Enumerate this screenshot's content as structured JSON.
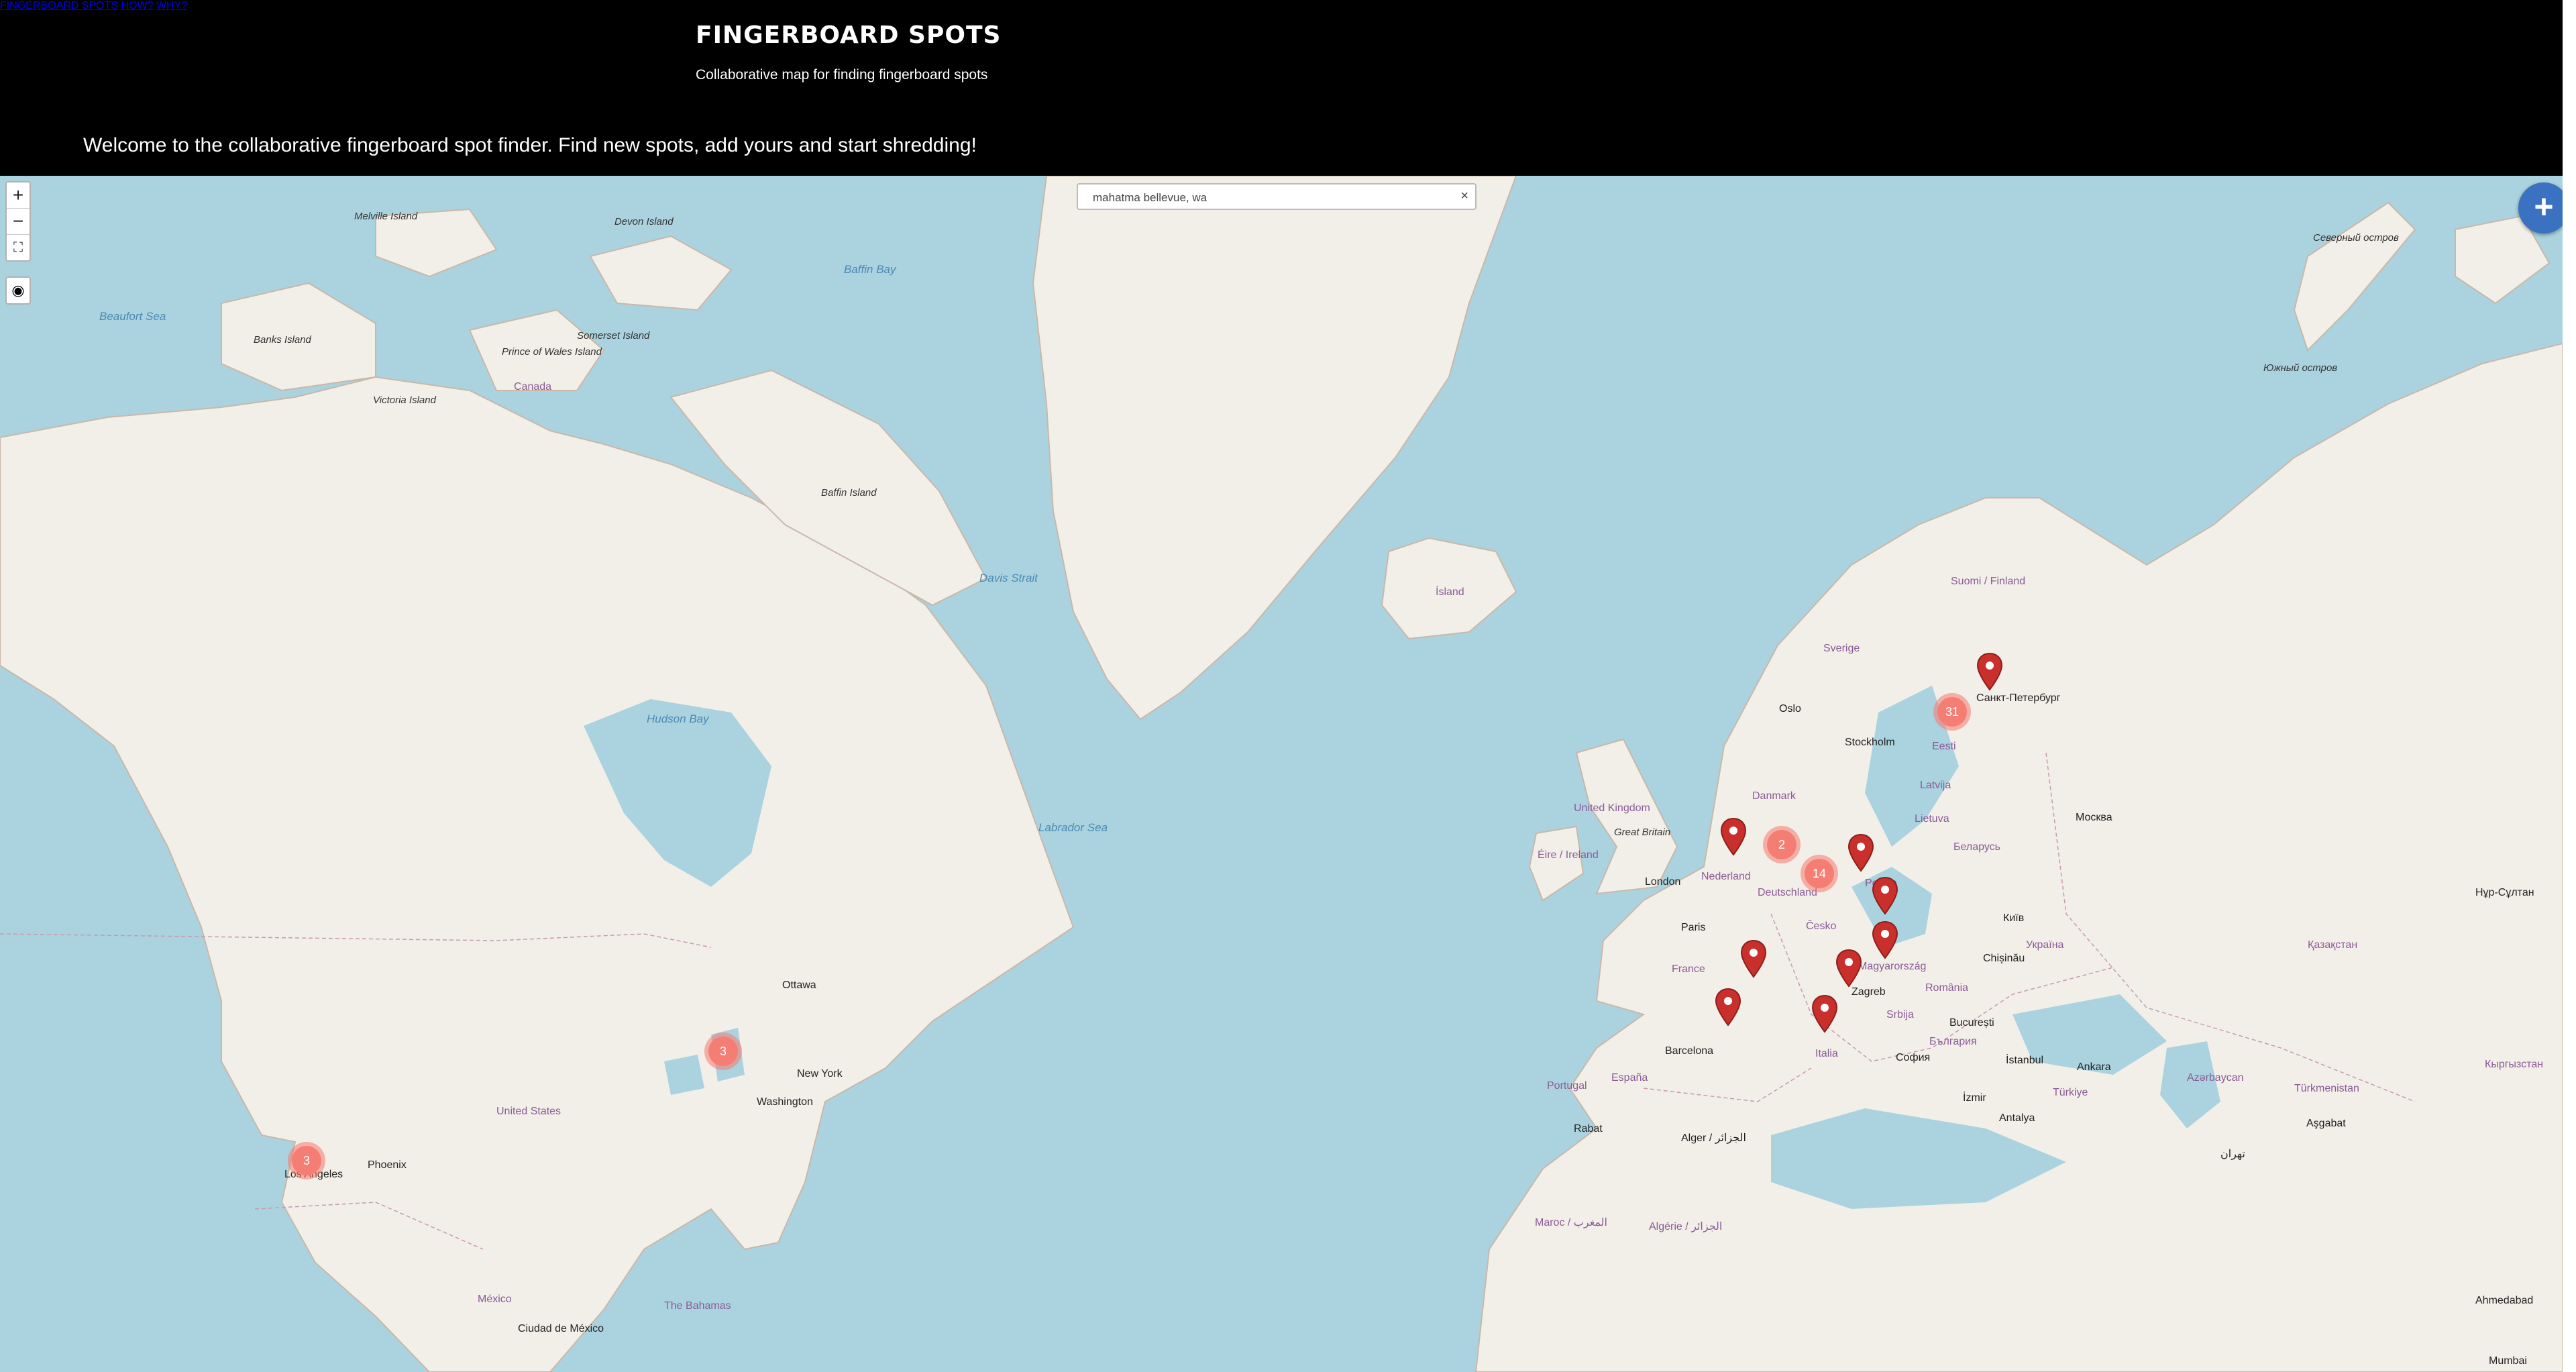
{
  "header": {
    "title": "FINGERBOARD SPOTS",
    "subtitle": "Collaborative map for finding fingerboard spots",
    "welcome": "Welcome to the collaborative fingerboard spot finder. Find new spots, add yours and start shredding!"
  },
  "nav": {
    "spots": "FINGERBOARD SPOTS",
    "how": "HOW?",
    "why": "WHY?"
  },
  "map": {
    "zoom_in": "+",
    "zoom_out": "−",
    "fullscreen": "⛶",
    "locate": "◉",
    "search": {
      "value": "mahatma bellevue, wa",
      "clear": "×"
    },
    "add_button": "+",
    "clusters": [
      {
        "count": "3",
        "id": "cluster-los-angeles"
      },
      {
        "count": "3",
        "id": "cluster-great-lakes"
      },
      {
        "count": "2",
        "id": "cluster-netherlands"
      },
      {
        "count": "14",
        "id": "cluster-germany"
      },
      {
        "count": "31",
        "id": "cluster-baltic"
      }
    ],
    "labels": {
      "baffin_bay": "Baffin Bay",
      "beaufort_sea": "Beaufort Sea",
      "labrador_sea": "Labrador Sea",
      "davis_strait": "Davis Strait",
      "hudson_bay": "Hudson Bay",
      "victoria_island": "Victoria Island",
      "banks_island": "Banks Island",
      "baffin_island": "Baffin Island",
      "prince_of_wales": "Prince of Wales Island",
      "somerset": "Somerset Island",
      "devon": "Devon Island",
      "melville": "Melville Island",
      "canada": "Canada",
      "united_states": "United States",
      "mexico": "México",
      "phoenix": "Phoenix",
      "los_angeles": "Los Angeles",
      "ottawa": "Ottawa",
      "new_york": "New York",
      "washington": "Washington",
      "bahamas": "The Bahamas",
      "ciudad_mexico": "Ciudad de México",
      "island": "Ísland",
      "uk": "United Kingdom",
      "great_britain": "Great Britain",
      "eire": "Éire / Ireland",
      "london": "London",
      "paris": "Paris",
      "france": "France",
      "espana": "España",
      "portugal": "Portugal",
      "barcelona": "Barcelona",
      "nederland": "Nederland",
      "deutschland": "Deutschland",
      "danmark": "Danmark",
      "cesko": "Česko",
      "oslo": "Oslo",
      "stockholm": "Stockholm",
      "sverige": "Sverige",
      "suomi": "Suomi / Finland",
      "st_petersburg": "Санкт-Петербург",
      "belarus": "Беларусь",
      "ukraine": "Україна",
      "kyiv": "Київ",
      "moscow": "Москва",
      "zagreb": "Zagreb",
      "bucuresti": "București",
      "romania": "România",
      "balgariya": "България",
      "italia": "Italia",
      "istanbul": "İstanbul",
      "turkiye": "Türkiye",
      "antalya": "Antalya",
      "izmir": "İzmir",
      "algiers": "Alger / الجزائر",
      "maroc": "Maroc / المغرب",
      "algerie": "Algérie / الجزائر",
      "rabat": "Rabat",
      "kazakhstan": "Қазақстан",
      "turkmenistan": "Türkmenistan",
      "ashgabat": "Aşgabat",
      "ahmedabad": "Ahmedabad",
      "mumbai": "Mumbai",
      "lietuva": "Lietuva",
      "latvija": "Latvija",
      "eesti": "Eesti",
      "polska": "Polska",
      "magyarorszag": "Magyarország",
      "srbija": "Srbija",
      "sofia": "София",
      "chisinau": "Chișinău",
      "azerbaijan": "Azərbaycan",
      "kyrgyzstan": "Кыргызстан",
      "nur_sultan": "Нұр-Сұлтан",
      "ikonio": "Ankara",
      "tehran": "تهران",
      "novaya_zemlya": "Северный остров",
      "yuzhny": "Южный остров"
    }
  }
}
